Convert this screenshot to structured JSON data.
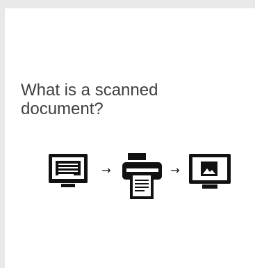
{
  "title": "What is a scanned\ndocument?",
  "flow": {
    "steps": [
      {
        "icon": "text-document-monitor-icon"
      },
      {
        "icon": "printer-scanner-icon"
      },
      {
        "icon": "image-document-monitor-icon"
      }
    ],
    "arrow_glyph": "→"
  },
  "colors": {
    "background": "#ffffff",
    "frame": "#e9e9e9",
    "title_text": "#3f3f3f",
    "icon": "#111111"
  }
}
